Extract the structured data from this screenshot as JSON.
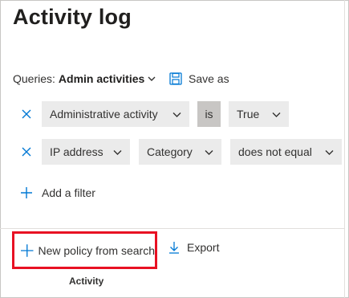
{
  "page": {
    "title": "Activity log"
  },
  "queries": {
    "label": "Queries:",
    "value": "Admin activities",
    "save_as_label": "Save as"
  },
  "filters": [
    {
      "field": "Administrative activity",
      "operator": "is",
      "value": "True"
    },
    {
      "field": "IP address",
      "operator": "Category",
      "value": "does not equal"
    }
  ],
  "add_filter_label": "Add a filter",
  "actions": {
    "new_policy_label": "New policy from search",
    "export_label": "Export"
  },
  "table": {
    "columns": [
      "Activity"
    ]
  },
  "colors": {
    "accent": "#0078d4",
    "highlight_border": "#e81123",
    "pill_bg": "#ebebeb",
    "is_bg": "#c8c6c4"
  },
  "icons": {
    "remove": "close-icon",
    "dropdown": "chevron-down-icon",
    "save": "save-icon",
    "add": "plus-icon",
    "export": "download-icon"
  }
}
